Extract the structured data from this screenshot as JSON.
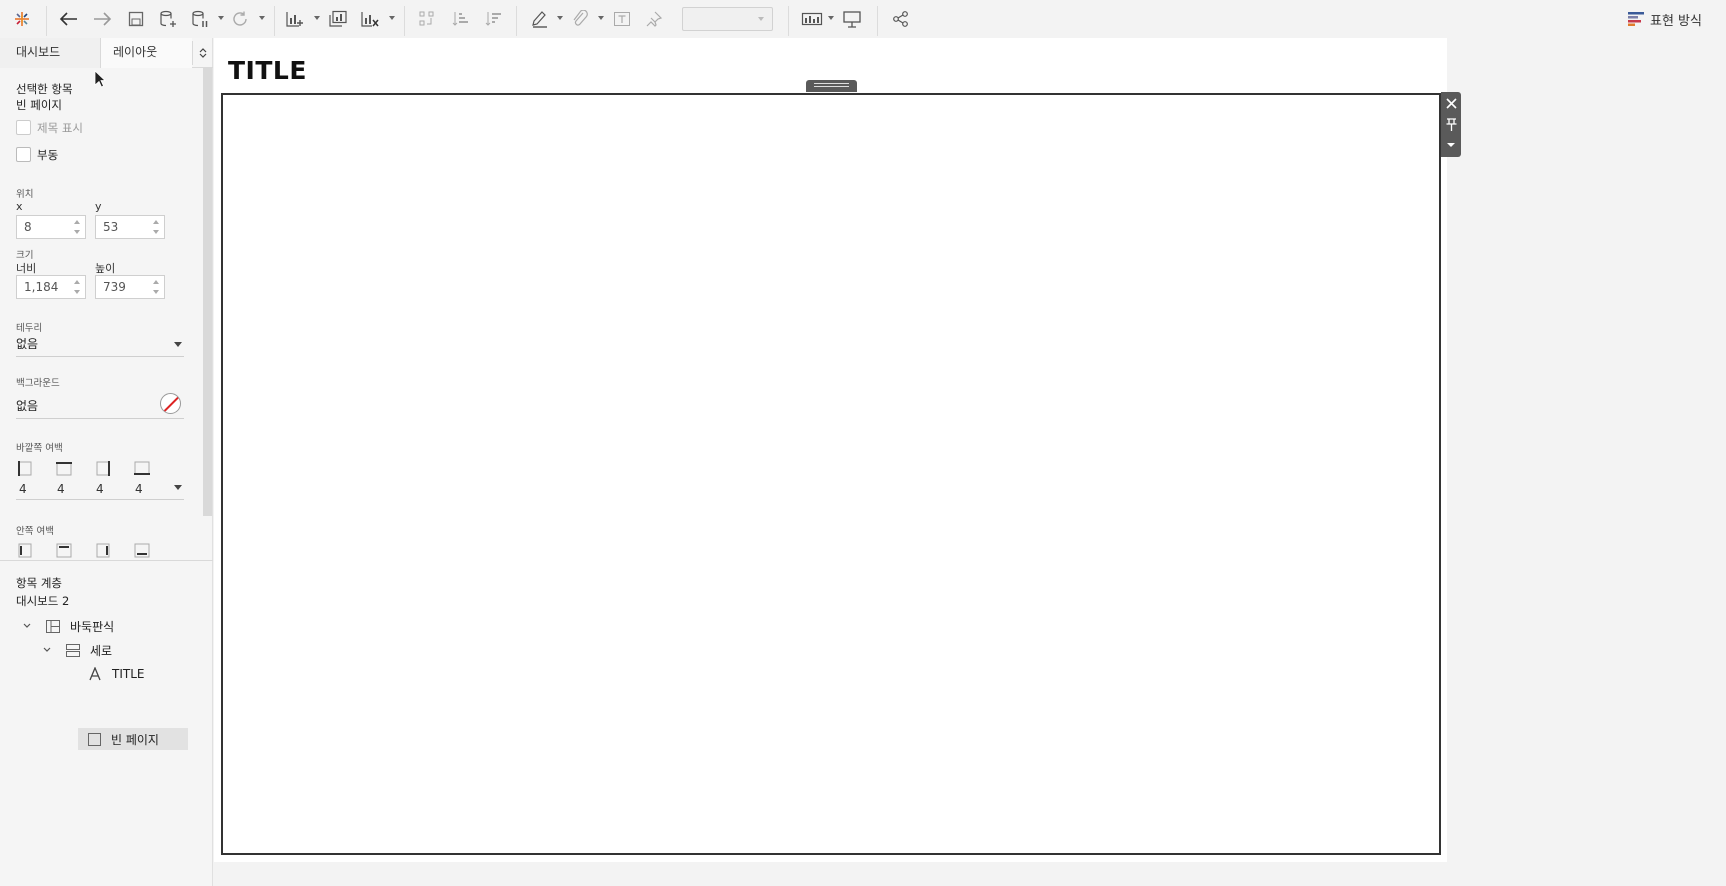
{
  "toolbar": {
    "show_me_label": "표현 방식",
    "icons": [
      "tableau-logo-icon",
      "undo-icon",
      "redo-icon",
      "save-icon",
      "new-datasource-icon",
      "pause-updates-icon",
      "refresh-icon",
      "new-worksheet-icon",
      "duplicate-icon",
      "clear-sheet-icon",
      "swap-icon",
      "sort-asc-icon",
      "sort-desc-icon",
      "highlight-icon",
      "group-icon",
      "label-icon",
      "pin-icon",
      "fit-combo",
      "show-cards-icon",
      "presentation-icon",
      "share-icon"
    ]
  },
  "left_panel": {
    "tabs": {
      "dashboard": "대시보드",
      "layout": "레이아웃"
    },
    "selected_item": {
      "heading": "선택한 항목",
      "name": "빈 페이지"
    },
    "show_title": "제목 표시",
    "floating": "부동",
    "position": {
      "label": "위치",
      "x_label": "x",
      "y_label": "y",
      "x": "8",
      "y": "53"
    },
    "size": {
      "label": "크기",
      "width_label": "너비",
      "height_label": "높이",
      "width": "1,184",
      "height": "739"
    },
    "border": {
      "label": "테두리",
      "value": "없음"
    },
    "background": {
      "label": "백그라운드",
      "value": "없음"
    },
    "outer_padding": {
      "label": "바깥쪽 여백",
      "values": [
        "4",
        "4",
        "4",
        "4"
      ]
    },
    "inner_padding": {
      "label": "안쪽 여백"
    },
    "item_hierarchy": {
      "heading": "항목 계층",
      "dashboard_name": "대시보드 2",
      "tiled": "바둑판식",
      "vertical": "세로",
      "title_item": "TITLE",
      "blank_item": "빈 페이지"
    }
  },
  "canvas": {
    "title": "TITLE"
  },
  "colors": {
    "selection_border": "#333333",
    "object_toolbar": "#5a5a5a"
  }
}
